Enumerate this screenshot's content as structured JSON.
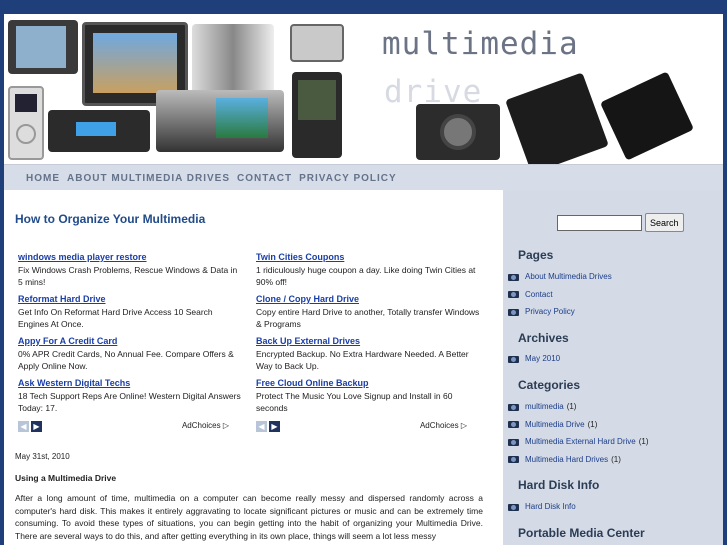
{
  "header": {
    "title": "multimedia",
    "subtitle": "drive"
  },
  "nav": {
    "items": [
      "HOME",
      "ABOUT MULTIMEDIA DRIVES",
      "CONTACT",
      "PRIVACY POLICY"
    ]
  },
  "post": {
    "title": "How to Organize Your Multimedia",
    "date": "May 31st, 2010",
    "subtitle": "Using a Multimedia Drive",
    "body": "After a long amount of time, multimedia on a computer can become really messy and dispersed randomly across a computer's hard disk. This makes it entirely aggravating to locate significant pictures or music and can be extremely time consuming. To avoid these types of situations, you can begin getting into the habit of organizing your Multimedia Drive. There are several ways to do this, and after getting everything in its own place, things will seem a lot less messy"
  },
  "ads": {
    "left": [
      {
        "link": "windows media player restore",
        "desc": "Fix Windows Crash Problems, Rescue Windows & Data in 5 mins!"
      },
      {
        "link": "Reformat Hard Drive",
        "desc": "Get Info On Reformat Hard Drive Access 10 Search Engines At Once."
      },
      {
        "link": "Appy For A Credit Card",
        "desc": "0% APR Credit Cards, No Annual Fee. Compare Offers & Apply Online Now."
      },
      {
        "link": "Ask Western Digital Techs",
        "desc": "18 Tech Support Reps Are Online! Western Digital Answers Today: 17."
      }
    ],
    "right": [
      {
        "link": "Twin Cities Coupons",
        "desc": "1 ridiculously huge coupon a day. Like doing Twin Cities at 90% off!"
      },
      {
        "link": "Clone / Copy Hard Drive",
        "desc": "Copy entire Hard Drive to another, Totally transfer Windows & Programs"
      },
      {
        "link": "Back Up External Drives",
        "desc": "Encrypted Backup. No Extra Hardware Needed. A Better Way to Back Up."
      },
      {
        "link": "Free Cloud Online Backup",
        "desc": "Protect The Music You Love Signup and Install in 60 seconds"
      }
    ],
    "adchoices": "AdChoices ▷"
  },
  "sidebar": {
    "search_button": "Search",
    "search_value": "",
    "pages_title": "Pages",
    "pages": [
      "About Multimedia Drives",
      "Contact",
      "Privacy Policy"
    ],
    "archives_title": "Archives",
    "archives": [
      "May 2010"
    ],
    "categories_title": "Categories",
    "categories": [
      {
        "name": "multimedia",
        "count": "(1)"
      },
      {
        "name": "Multimedia Drive",
        "count": "(1)"
      },
      {
        "name": "Multimedia External Hard Drive",
        "count": "(1)"
      },
      {
        "name": "Multimedia Hard Drives",
        "count": "(1)"
      }
    ],
    "hdd_title": "Hard Disk Info",
    "hdd": [
      "Hard Disk Info"
    ],
    "pmc_title": "Portable Media Center"
  },
  "colors": {
    "frame": "#1e3f7a",
    "nav_bg": "#d6dde8",
    "sidebar_bg": "#d4dbe6",
    "link": "#1a3ea6",
    "title": "#214b8a"
  }
}
